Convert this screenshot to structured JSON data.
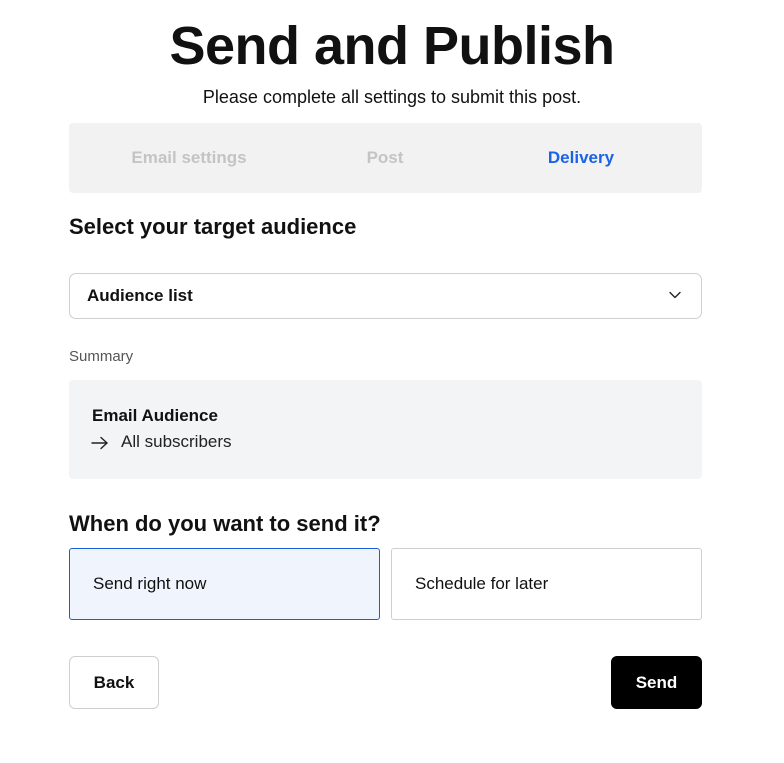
{
  "header": {
    "title": "Send and Publish",
    "subtitle": "Please complete all settings to submit this post."
  },
  "steps": [
    {
      "label": "Email settings",
      "state": "inactive"
    },
    {
      "label": "Post",
      "state": "inactive"
    },
    {
      "label": "Delivery",
      "state": "active"
    }
  ],
  "audience": {
    "heading": "Select your target audience",
    "select_value": "Audience list"
  },
  "summary": {
    "label": "Summary",
    "title": "Email Audience",
    "value": "All subscribers"
  },
  "timing": {
    "heading": "When do you want to send it?",
    "options": [
      {
        "label": "Send right now",
        "selected": true
      },
      {
        "label": "Schedule for later",
        "selected": false
      }
    ]
  },
  "actions": {
    "back_label": "Back",
    "send_label": "Send"
  },
  "colors": {
    "accent": "#1a63e6",
    "selected_bg": "#f0f5fd",
    "primary_button": "#000000"
  },
  "icons": {
    "select": "chevron-down-icon",
    "summary": "arrow-right-icon"
  }
}
